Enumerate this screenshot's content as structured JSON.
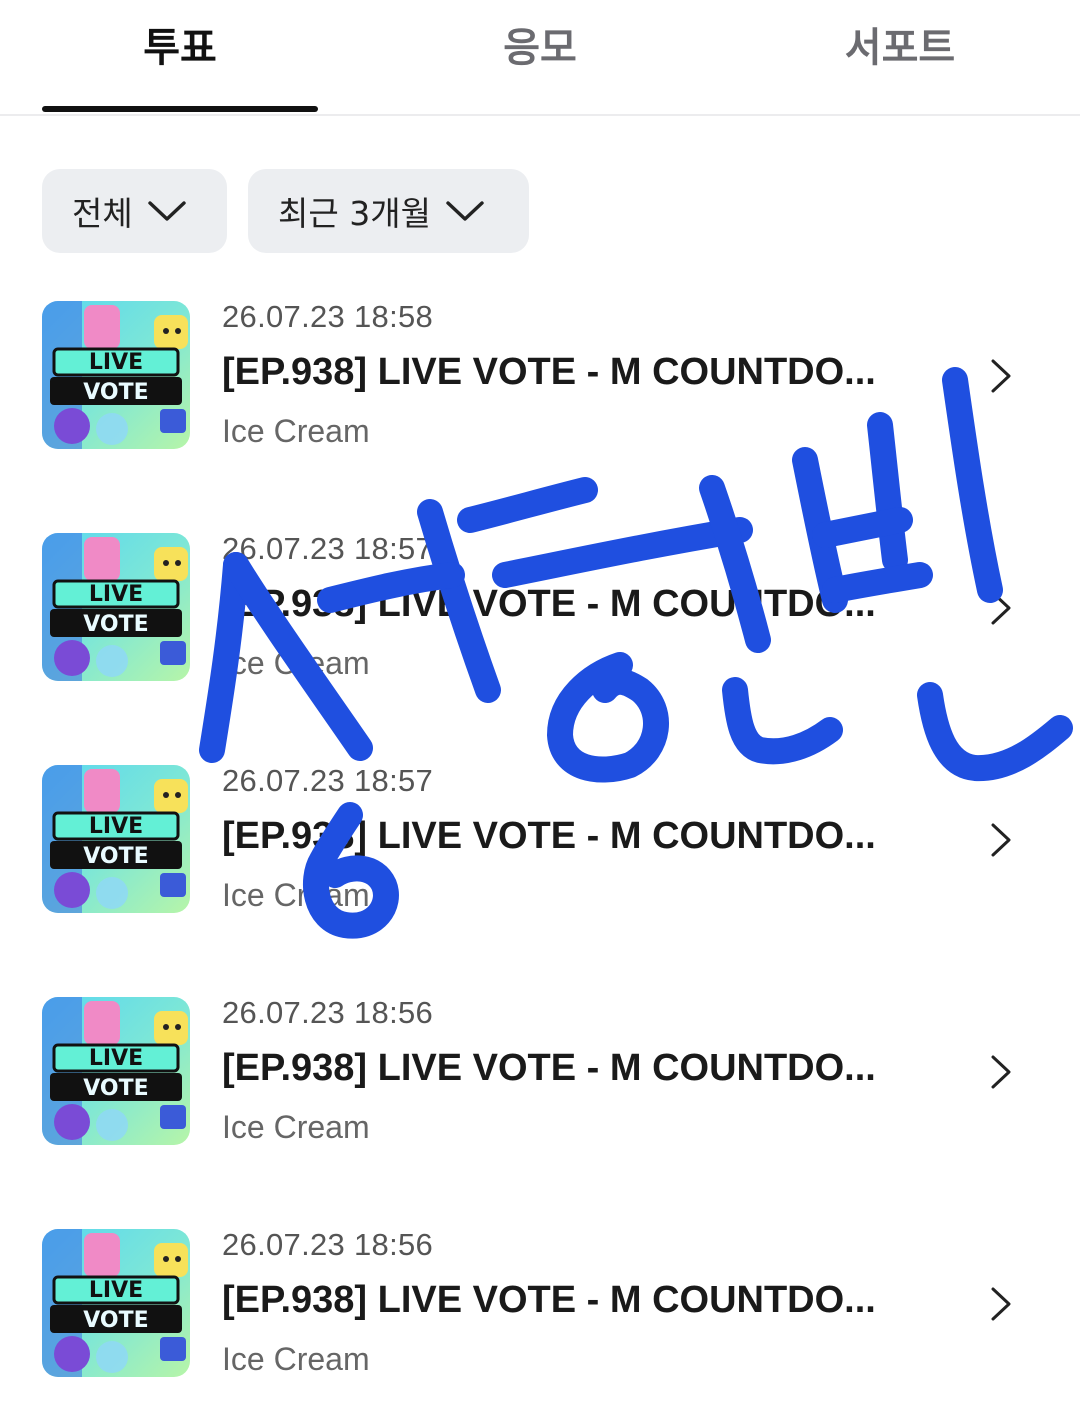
{
  "tabs": [
    {
      "label": "투표",
      "active": true
    },
    {
      "label": "응모",
      "active": false
    },
    {
      "label": "서포트",
      "active": false
    }
  ],
  "filters": {
    "category": "전체",
    "period": "최근 3개월"
  },
  "thumbnail": {
    "line1": "LIVE",
    "line2": "VOTE"
  },
  "items": [
    {
      "date": "26.07.23 18:58",
      "title": "[EP.938] LIVE VOTE - M COUNTDO...",
      "subtitle": "Ice Cream"
    },
    {
      "date": "26.07.23 18:57",
      "title": "[EP.938] LIVE VOTE - M COUNTDO...",
      "subtitle": "Ice Cream"
    },
    {
      "date": "26.07.23 18:57",
      "title": "[EP.938] LIVE VOTE - M COUNTDO...",
      "subtitle": "Ice Cream"
    },
    {
      "date": "26.07.23 18:56",
      "title": "[EP.938] LIVE VOTE - M COUNTDO...",
      "subtitle": "Ice Cream"
    },
    {
      "date": "26.07.23 18:56",
      "title": "[EP.938] LIVE VOTE - M COUNTDO...",
      "subtitle": "Ice Cream"
    }
  ],
  "colors": {
    "scribble": "#1f4fe0",
    "filter_bg": "#eceef1",
    "active_tab": "#111111"
  }
}
